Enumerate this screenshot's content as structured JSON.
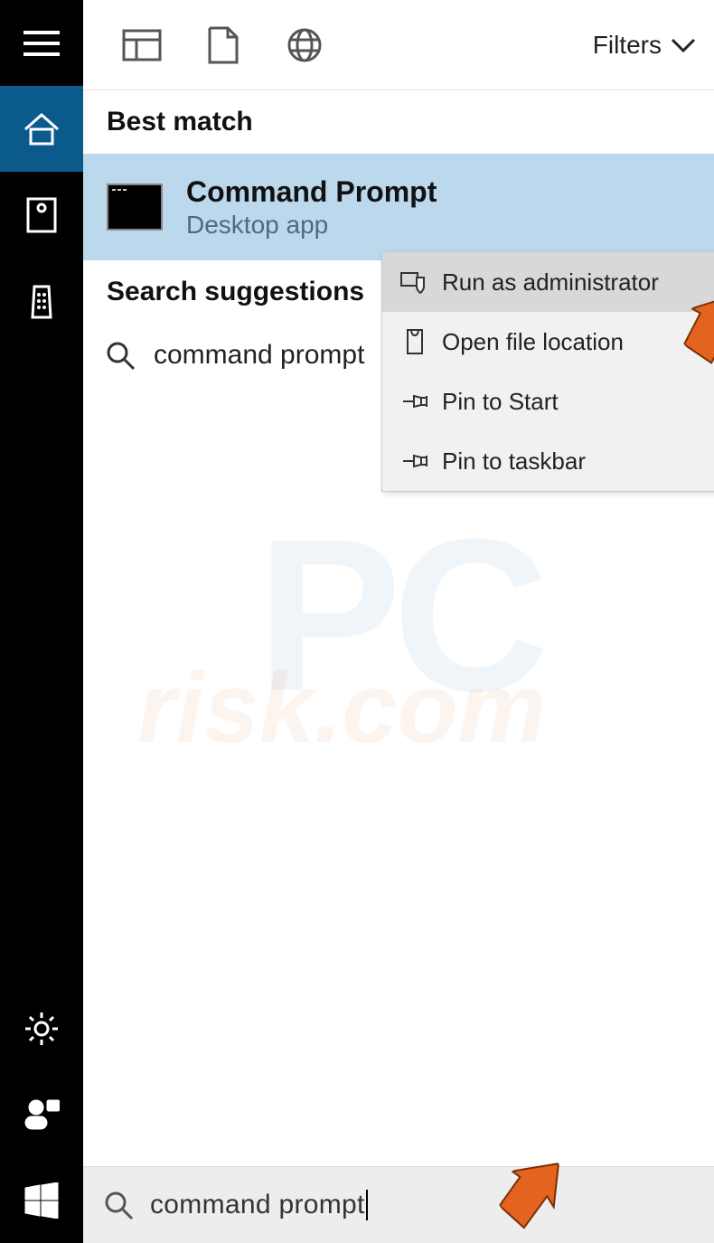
{
  "toprow": {
    "filters_label": "Filters"
  },
  "sections": {
    "best_match": "Best match",
    "suggestions": "Search suggestions"
  },
  "result": {
    "title": "Command Prompt",
    "subtitle": "Desktop app"
  },
  "suggestion": {
    "text": "command prompt"
  },
  "contextmenu": {
    "items": [
      {
        "label": "Run as administrator",
        "icon": "shield"
      },
      {
        "label": "Open file location",
        "icon": "folder"
      },
      {
        "label": "Pin to Start",
        "icon": "pin"
      },
      {
        "label": "Pin to taskbar",
        "icon": "pin"
      }
    ]
  },
  "searchbar": {
    "query": "command prompt"
  },
  "watermark": {
    "line1": "PC",
    "line2": "risk.com"
  }
}
